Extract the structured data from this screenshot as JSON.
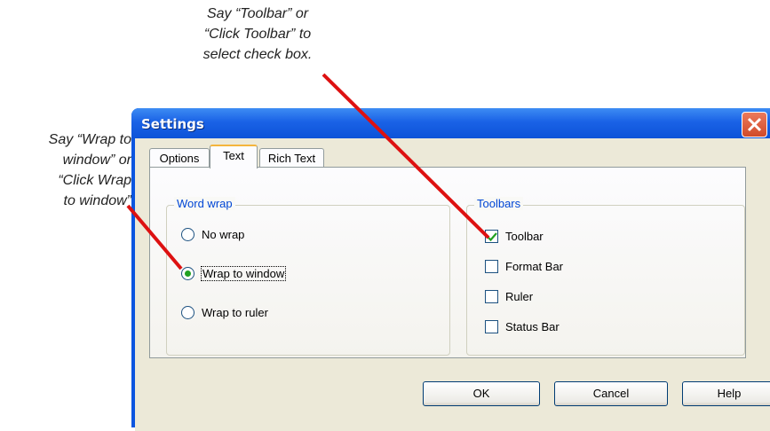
{
  "callouts": {
    "toolbar": [
      "Say “Toolbar” or",
      "“Click Toolbar” to",
      "select check box."
    ],
    "wrap": [
      "Say “Wrap to",
      "window” or",
      "“Click Wrap",
      "to window”"
    ]
  },
  "dialog": {
    "title": "Settings",
    "tabs": [
      {
        "label": "Options",
        "selected": false
      },
      {
        "label": "Text",
        "selected": true
      },
      {
        "label": "Rich Text",
        "selected": false
      }
    ],
    "word_wrap": {
      "legend": "Word wrap",
      "options": [
        {
          "label": "No wrap",
          "selected": false
        },
        {
          "label": "Wrap to window",
          "selected": true
        },
        {
          "label": "Wrap to ruler",
          "selected": false
        }
      ]
    },
    "toolbars": {
      "legend": "Toolbars",
      "items": [
        {
          "label": "Toolbar",
          "checked": true
        },
        {
          "label": "Format Bar",
          "checked": false
        },
        {
          "label": "Ruler",
          "checked": false
        },
        {
          "label": "Status Bar",
          "checked": false
        }
      ]
    },
    "buttons": {
      "ok": "OK",
      "cancel": "Cancel",
      "help": "Help"
    }
  },
  "colors": {
    "accent": "#0a55e0",
    "arrow": "#dd1111",
    "radio_dot": "#21a121",
    "close": "#d04a2a"
  }
}
